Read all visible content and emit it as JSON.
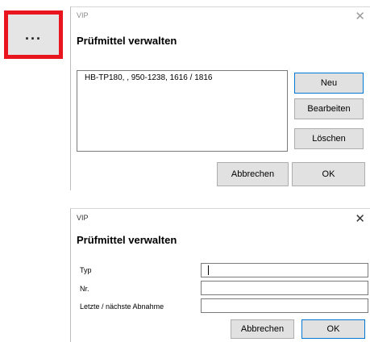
{
  "launcher": {
    "label": "..."
  },
  "dialog_list": {
    "window_title": "VIP",
    "heading": "Prüfmittel verwalten",
    "items": [
      "HB-TP180, , 950-1238, 1616 / 1816"
    ],
    "buttons": {
      "new": "Neu",
      "edit": "Bearbeiten",
      "delete": "Löschen",
      "cancel": "Abbrechen",
      "ok": "OK"
    }
  },
  "dialog_edit": {
    "window_title": "VIP",
    "heading": "Prüfmittel verwalten",
    "fields": [
      {
        "label": "Typ",
        "value": ""
      },
      {
        "label": "Nr.",
        "value": ""
      },
      {
        "label": "Letzte / nächste Abnahme",
        "value": ""
      }
    ],
    "buttons": {
      "cancel": "Abbrechen",
      "ok": "OK"
    }
  },
  "icons": {
    "close": "close-icon",
    "launcher_border_color": "#e8141e",
    "accent": "#0078d7"
  }
}
